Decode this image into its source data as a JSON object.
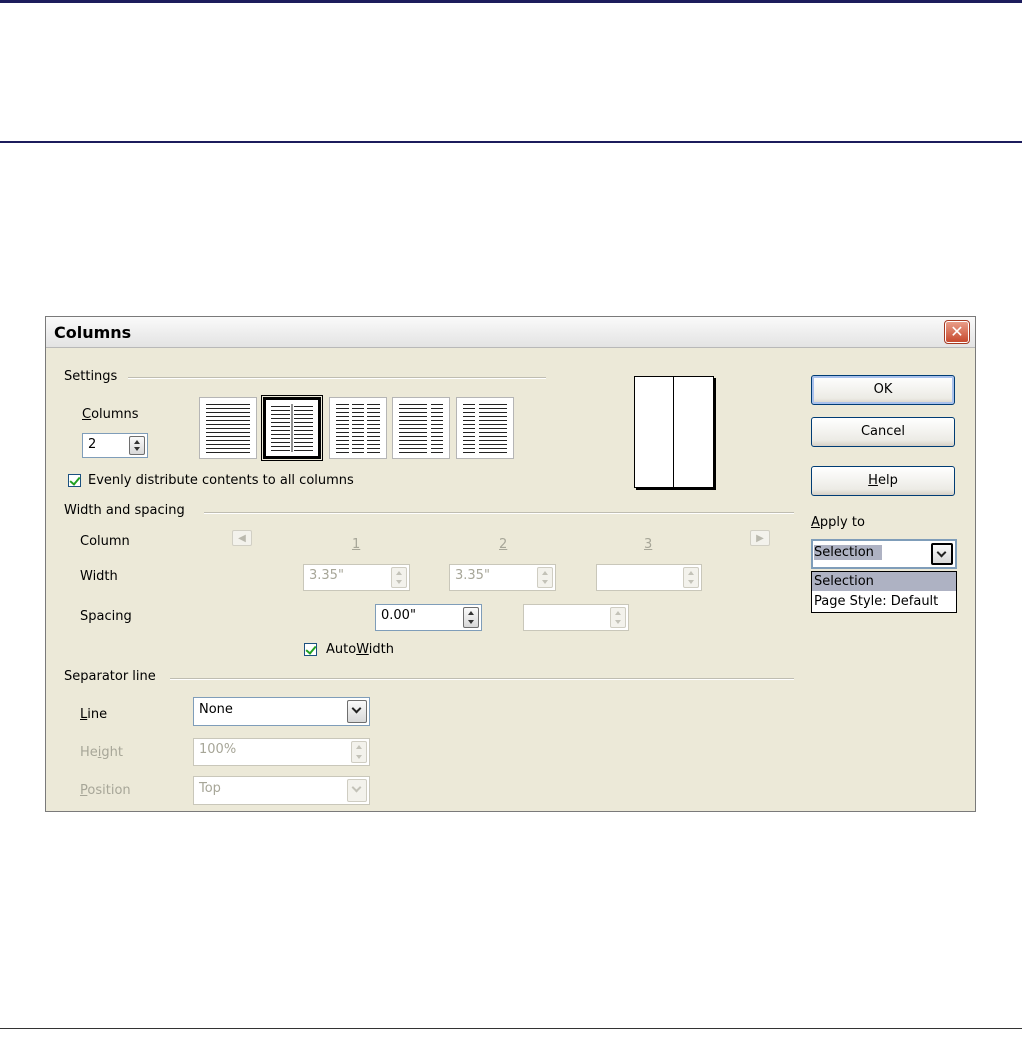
{
  "dialog": {
    "title": "Columns",
    "close_icon": "close-x-icon"
  },
  "settings": {
    "group_label": "Settings",
    "columns_label": "Columns",
    "columns_value": "2",
    "evenly_label": "Evenly distribute contents to all columns",
    "evenly_checked": true,
    "selected_preset": 2
  },
  "width_spacing": {
    "group_label": "Width and spacing",
    "column_label": "Column",
    "width_label": "Width",
    "spacing_label": "Spacing",
    "col_numbers": [
      "1",
      "2",
      "3"
    ],
    "widths": [
      "3.35\"",
      "3.35\"",
      ""
    ],
    "spacings": [
      "0.00\"",
      ""
    ],
    "autowidth_label": "AutoWidth",
    "autowidth_checked": true
  },
  "separator": {
    "group_label": "Separator line",
    "line_label": "Line",
    "line_value": "None",
    "height_label": "Height",
    "height_value": "100%",
    "position_label": "Position",
    "position_value": "Top"
  },
  "buttons": {
    "ok": "OK",
    "cancel": "Cancel",
    "help": "Help"
  },
  "apply_to": {
    "label": "Apply to",
    "value": "Selection",
    "options": [
      "Selection",
      "Page Style: Default"
    ]
  }
}
